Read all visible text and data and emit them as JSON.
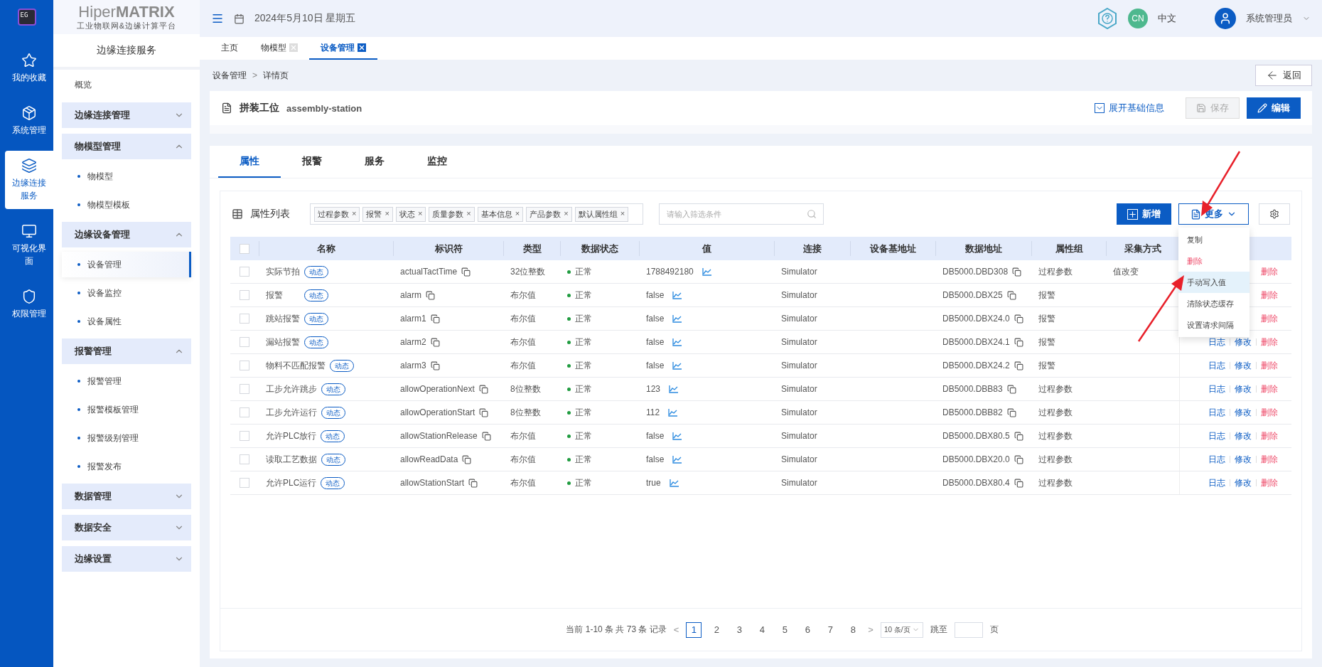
{
  "rail": {
    "logo": "EG",
    "items": [
      {
        "label": "我的收藏",
        "kind": "star",
        "selected": false
      },
      {
        "label": "系统管理",
        "kind": "box",
        "selected": false
      },
      {
        "label": "边缘连接服务",
        "kind": "link",
        "selected": true
      },
      {
        "label": "可视化界面",
        "kind": "monitor",
        "selected": false
      },
      {
        "label": "权限管理",
        "kind": "shield",
        "selected": false
      }
    ]
  },
  "brand": {
    "name": "Hiper**MATRIX**",
    "subtitle": "工业物联网&边缘计算平台"
  },
  "sidebar": {
    "title": "边缘连接服务",
    "items": [
      {
        "label": "概览",
        "kind": "link"
      },
      {
        "label": "边缘连接管理",
        "kind": "group",
        "expanded": false
      },
      {
        "label": "物模型管理",
        "kind": "group",
        "expanded": true,
        "children": [
          {
            "label": "物模型",
            "selected": false
          },
          {
            "label": "物模型模板",
            "selected": false
          }
        ]
      },
      {
        "label": "边缘设备管理",
        "kind": "group",
        "expanded": true,
        "children": [
          {
            "label": "设备管理",
            "selected": true
          },
          {
            "label": "设备监控",
            "selected": false
          },
          {
            "label": "设备属性",
            "selected": false
          }
        ]
      },
      {
        "label": "报警管理",
        "kind": "group",
        "expanded": true,
        "children": [
          {
            "label": "报警管理",
            "selected": false
          },
          {
            "label": "报警模板管理",
            "selected": false
          },
          {
            "label": "报警级别管理",
            "selected": false
          },
          {
            "label": "报警发布",
            "selected": false
          }
        ]
      },
      {
        "label": "数据管理",
        "kind": "group",
        "expanded": false
      },
      {
        "label": "数据安全",
        "kind": "group",
        "expanded": false
      },
      {
        "label": "边缘设置",
        "kind": "group",
        "expanded": false
      }
    ]
  },
  "header": {
    "date": "2024年5月10日 星期五",
    "language_badge": "CN",
    "language": "中文",
    "user": "系统管理员"
  },
  "page_tabs": [
    {
      "label": "主页",
      "closable": false,
      "selected": false
    },
    {
      "label": "物模型",
      "closable": true,
      "selected": false
    },
    {
      "label": "设备管理",
      "closable": true,
      "selected": true
    }
  ],
  "breadcrumb": [
    "设备管理",
    "详情页"
  ],
  "breadcrumb_separator": ">",
  "back_button": "返回",
  "device": {
    "name": "拼装工位",
    "code": "assembly-station",
    "expand_label": "展开基础信息",
    "save_button": {
      "label": "保存",
      "disabled": true
    },
    "edit_button": "编辑"
  },
  "detail_tabs": [
    {
      "label": "属性",
      "selected": true
    },
    {
      "label": "报警",
      "selected": false
    },
    {
      "label": "服务",
      "selected": false
    },
    {
      "label": "监控",
      "selected": false
    }
  ],
  "list_title": "属性列表",
  "filter_tags": [
    "过程参数",
    "报警",
    "状态",
    "质量参数",
    "基本信息",
    "产品参数",
    "默认属性组"
  ],
  "tag_remove": "×",
  "search": {
    "placeholder": "请输入筛选条件"
  },
  "add_button": "新增",
  "more_button": "更多",
  "more_menu": [
    {
      "label": "复制",
      "kind": "normal",
      "selected": false
    },
    {
      "label": "删除",
      "kind": "danger",
      "selected": false
    },
    {
      "label": "手动写入值",
      "kind": "normal",
      "selected": true
    },
    {
      "label": "清除状态缓存",
      "kind": "normal",
      "selected": false
    },
    {
      "label": "设置请求间隔",
      "kind": "normal",
      "selected": false
    }
  ],
  "table": {
    "all_checked": false,
    "columns": [
      "名称",
      "标识符",
      "类型",
      "数据状态",
      "值",
      "连接",
      "设备基地址",
      "数据地址",
      "属性组",
      "采集方式"
    ],
    "rows": [
      {
        "checked": false,
        "name": "实际节拍",
        "tag": "动态",
        "identifier": "actualTactTime",
        "type": "32位整数",
        "status": "正常",
        "value": "1788492180",
        "connection": "Simulator",
        "address": "DB5000.DBD308",
        "group": "过程参数",
        "collect": "值改变",
        "actions": [
          {
            "label": "删除",
            "kind": "delete"
          }
        ]
      },
      {
        "checked": false,
        "name": "报警",
        "tag": "动态",
        "identifier": "alarm",
        "type": "布尔值",
        "status": "正常",
        "value": "false",
        "connection": "Simulator",
        "address": "DB5000.DBX25",
        "group": "报警",
        "actions": [
          {
            "label": "删除",
            "kind": "delete"
          }
        ]
      },
      {
        "checked": false,
        "name": "跳站报警",
        "tag": "动态",
        "identifier": "alarm1",
        "type": "布尔值",
        "status": "正常",
        "value": "false",
        "connection": "Simulator",
        "address": "DB5000.DBX24.0",
        "group": "报警",
        "actions": [
          {
            "label": "删除",
            "kind": "delete"
          }
        ]
      },
      {
        "checked": false,
        "name": "漏站报警",
        "tag": "动态",
        "identifier": "alarm2",
        "type": "布尔值",
        "status": "正常",
        "value": "false",
        "connection": "Simulator",
        "address": "DB5000.DBX24.1",
        "group": "报警",
        "actions": [
          {
            "label": "日志",
            "kind": "log"
          },
          {
            "label": "修改",
            "kind": "edit"
          },
          {
            "label": "删除",
            "kind": "delete"
          }
        ]
      },
      {
        "checked": false,
        "name": "物料不匹配报警",
        "tag": "动态",
        "identifier": "alarm3",
        "type": "布尔值",
        "status": "正常",
        "value": "false",
        "connection": "Simulator",
        "address": "DB5000.DBX24.2",
        "group": "报警",
        "actions": [
          {
            "label": "日志",
            "kind": "log"
          },
          {
            "label": "修改",
            "kind": "edit"
          },
          {
            "label": "删除",
            "kind": "delete"
          }
        ]
      },
      {
        "checked": false,
        "name": "工步允许跳步",
        "tag": "动态",
        "identifier": "allowOperationNext",
        "type": "8位整数",
        "status": "正常",
        "value": "123",
        "connection": "Simulator",
        "address": "DB5000.DBB83",
        "group": "过程参数",
        "actions": [
          {
            "label": "日志",
            "kind": "log"
          },
          {
            "label": "修改",
            "kind": "edit"
          },
          {
            "label": "删除",
            "kind": "delete"
          }
        ]
      },
      {
        "checked": false,
        "name": "工步允许运行",
        "tag": "动态",
        "identifier": "allowOperationStart",
        "type": "8位整数",
        "status": "正常",
        "value": "112",
        "connection": "Simulator",
        "address": "DB5000.DBB82",
        "group": "过程参数",
        "actions": [
          {
            "label": "日志",
            "kind": "log"
          },
          {
            "label": "修改",
            "kind": "edit"
          },
          {
            "label": "删除",
            "kind": "delete"
          }
        ]
      },
      {
        "checked": false,
        "name": "允许PLC放行",
        "tag": "动态",
        "identifier": "allowStationRelease",
        "type": "布尔值",
        "status": "正常",
        "value": "false",
        "connection": "Simulator",
        "address": "DB5000.DBX80.5",
        "group": "过程参数",
        "actions": [
          {
            "label": "日志",
            "kind": "log"
          },
          {
            "label": "修改",
            "kind": "edit"
          },
          {
            "label": "删除",
            "kind": "delete"
          }
        ]
      },
      {
        "checked": false,
        "name": "读取工艺数据",
        "tag": "动态",
        "identifier": "allowReadData",
        "type": "布尔值",
        "status": "正常",
        "value": "false",
        "connection": "Simulator",
        "address": "DB5000.DBX20.0",
        "group": "过程参数",
        "actions": [
          {
            "label": "日志",
            "kind": "log"
          },
          {
            "label": "修改",
            "kind": "edit"
          },
          {
            "label": "删除",
            "kind": "delete"
          }
        ]
      },
      {
        "checked": false,
        "name": "允许PLC运行",
        "tag": "动态",
        "identifier": "allowStationStart",
        "type": "布尔值",
        "status": "正常",
        "value": "true",
        "connection": "Simulator",
        "address": "DB5000.DBX80.4",
        "group": "过程参数",
        "actions": [
          {
            "label": "日志",
            "kind": "log"
          },
          {
            "label": "修改",
            "kind": "edit"
          },
          {
            "label": "删除",
            "kind": "delete"
          }
        ]
      }
    ]
  },
  "pagination": {
    "summary": "当前 1-10 条 共 73 条 记录",
    "prev": "<",
    "next": ">",
    "pages": [
      {
        "label": "1",
        "selected": true
      },
      {
        "label": "2",
        "selected": false
      },
      {
        "label": "3",
        "selected": false
      },
      {
        "label": "4",
        "selected": false
      },
      {
        "label": "5",
        "selected": false
      },
      {
        "label": "6",
        "selected": false
      },
      {
        "label": "7",
        "selected": false
      },
      {
        "label": "8",
        "selected": false
      }
    ],
    "page_size": "10 条/页",
    "jump_label": "跳至",
    "jump_suffix": "页"
  }
}
